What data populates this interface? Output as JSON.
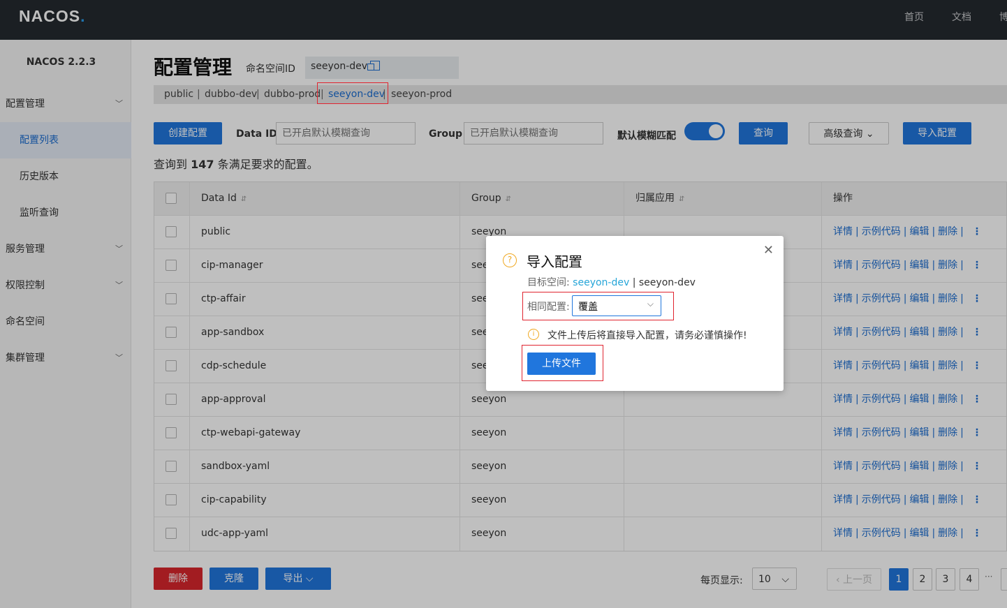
{
  "topbar": {
    "logo_text": "NACOS",
    "logo_dot": ".",
    "nav": [
      "首页",
      "文档",
      "博"
    ]
  },
  "sidebar": {
    "version": "NACOS 2.2.3",
    "items": [
      {
        "label": "配置管理",
        "expandable": true
      },
      {
        "label": "配置列表",
        "active": true
      },
      {
        "label": "历史版本"
      },
      {
        "label": "监听查询"
      },
      {
        "label": "服务管理",
        "expandable": true
      },
      {
        "label": "权限控制",
        "expandable": true
      },
      {
        "label": "命名空间"
      },
      {
        "label": "集群管理",
        "expandable": true
      }
    ]
  },
  "header": {
    "title": "配置管理",
    "namespace_label": "命名空间ID",
    "namespace_value": "seeyon-dev",
    "namespace_tabs": [
      "public",
      "dubbo-dev",
      "dubbo-prod",
      "seeyon-dev",
      "seeyon-prod"
    ],
    "separator": "|"
  },
  "filters": {
    "create_button": "创建配置",
    "data_id_label": "Data ID",
    "data_id_placeholder": "已开启默认模糊查询",
    "group_label": "Group",
    "group_placeholder": "已开启默认模糊查询",
    "fuzzy_label": "默认模糊匹配",
    "fuzzy_on": true,
    "query_button": "查询",
    "advanced_button": "高级查询",
    "advanced_chevron": "⌄",
    "import_button": "导入配置"
  },
  "result": {
    "prefix": "查询到",
    "count": "147",
    "suffix": "条满足要求的配置。"
  },
  "table": {
    "headers": [
      "Data Id",
      "Group",
      "归属应用",
      "操作"
    ],
    "sort_glyph": "⇵",
    "rows": [
      {
        "data_id": "public",
        "group": "seeyon",
        "app": ""
      },
      {
        "data_id": "cip-manager",
        "group": "see",
        "app": ""
      },
      {
        "data_id": "ctp-affair",
        "group": "see",
        "app": ""
      },
      {
        "data_id": "app-sandbox",
        "group": "see",
        "app": ""
      },
      {
        "data_id": "cdp-schedule",
        "group": "see",
        "app": ""
      },
      {
        "data_id": "app-approval",
        "group": "seeyon",
        "app": ""
      },
      {
        "data_id": "ctp-webapi-gateway",
        "group": "seeyon",
        "app": ""
      },
      {
        "data_id": "sandbox-yaml",
        "group": "seeyon",
        "app": ""
      },
      {
        "data_id": "cip-capability",
        "group": "seeyon",
        "app": ""
      },
      {
        "data_id": "udc-app-yaml",
        "group": "seeyon",
        "app": ""
      }
    ],
    "ops": [
      "详情",
      "示例代码",
      "编辑",
      "删除"
    ],
    "op_sep": "|",
    "more_glyph": "⋮"
  },
  "bottom": {
    "delete_button": "删除",
    "clone_button": "克隆",
    "export_button": "导出",
    "export_chevron": "⌵",
    "page_size_label": "每页显示:",
    "page_size": "10",
    "page_size_chevron": "⌵",
    "prev_button": "上一页",
    "prev_glyph": "‹",
    "pages": [
      "1",
      "2",
      "3",
      "4"
    ],
    "ellipsis": "···",
    "current_page": "1"
  },
  "dialog": {
    "help_glyph": "?",
    "title": "导入配置",
    "close_glyph": "✕",
    "target_label": "目标空间:",
    "target_ns_id": "seeyon-dev",
    "target_sep": "|",
    "target_ns_name": "seeyon-dev",
    "same_config_label": "相同配置:",
    "same_config_value": "覆盖",
    "select_chevron": "⌵",
    "warn_glyph": "i",
    "warning": "文件上传后将直接导入配置，请务必谨慎操作!",
    "upload_button": "上传文件"
  },
  "colors": {
    "primary": "#2076dd",
    "danger": "#d9262d",
    "highlight_box": "#e0242f",
    "warning": "#f0a821",
    "topbar": "#252a2f"
  }
}
